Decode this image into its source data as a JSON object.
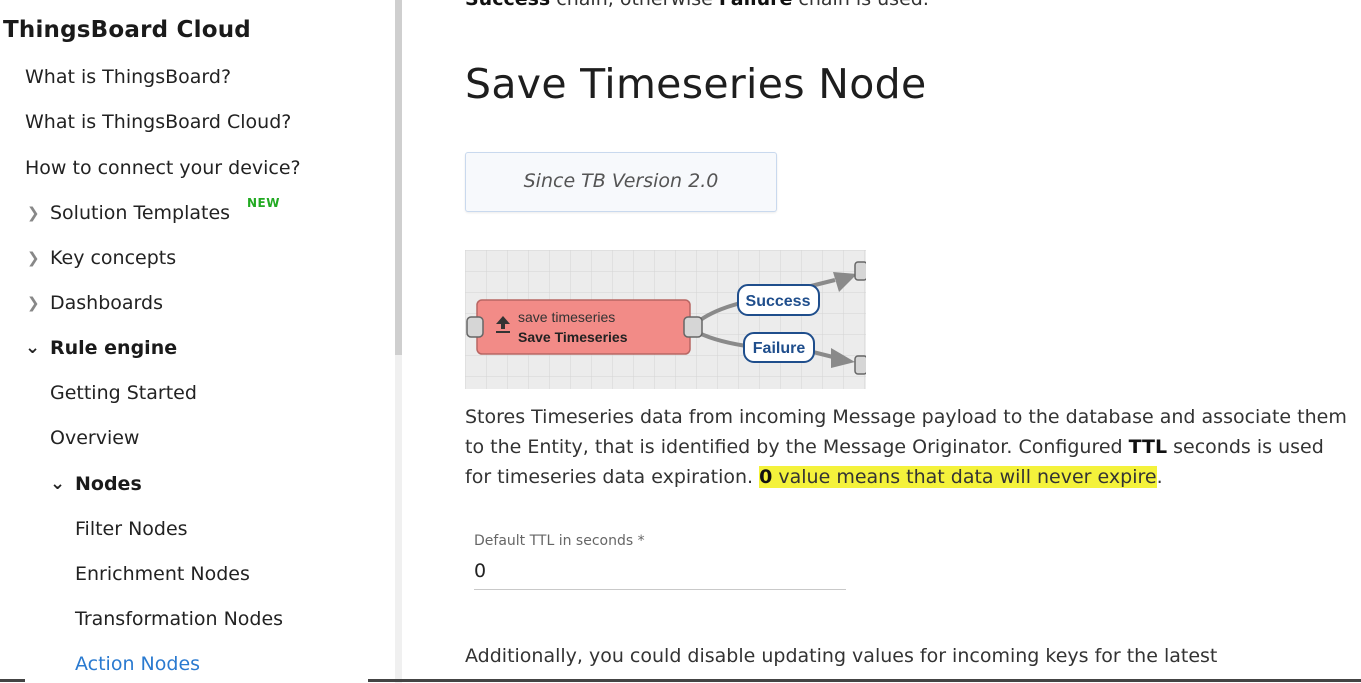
{
  "sidebar": {
    "title": "ThingsBoard Cloud",
    "new_badge": "NEW",
    "items": [
      {
        "label": "What is ThingsBoard?"
      },
      {
        "label": "What is ThingsBoard Cloud?"
      },
      {
        "label": "How to connect your device?"
      },
      {
        "label": "Solution Templates"
      },
      {
        "label": "Key concepts"
      },
      {
        "label": "Dashboards"
      },
      {
        "label": "Rule engine"
      },
      {
        "label": "Getting Started"
      },
      {
        "label": "Overview"
      },
      {
        "label": "Nodes"
      },
      {
        "label": "Filter Nodes"
      },
      {
        "label": "Enrichment Nodes"
      },
      {
        "label": "Transformation Nodes"
      },
      {
        "label": "Action Nodes"
      }
    ]
  },
  "main": {
    "cut_text_a": "Success",
    "cut_text_b": " chain, otherwise ",
    "cut_text_c": "Failure",
    "cut_text_d": " chain is used.",
    "title": "Save Timeseries Node",
    "version_label": "Since TB Version 2.0",
    "diagram": {
      "node_type": "save timeseries",
      "node_name": "Save Timeseries",
      "success_label": "Success",
      "failure_label": "Failure"
    },
    "description": {
      "part1": "Stores Timeseries data from incoming Message payload to the database and associate them to the Entity, that is identified by the Message Originator. Configured ",
      "ttl": "TTL",
      "part2": " seconds is used for timeseries data expiration. ",
      "zero": "0",
      "highlight_rest": " value means that data will never expire",
      "end": "."
    },
    "ttl_field": {
      "label": "Default TTL in seconds *",
      "value": "0"
    },
    "bottom_text": "Additionally, you could disable updating values for incoming keys for the latest"
  },
  "colors": {
    "link_active": "#2a7ad0",
    "new_badge": "#22aa22",
    "highlight": "#f4f23b",
    "node_fill": "#f28b87",
    "label_border": "#1f4e8c"
  }
}
